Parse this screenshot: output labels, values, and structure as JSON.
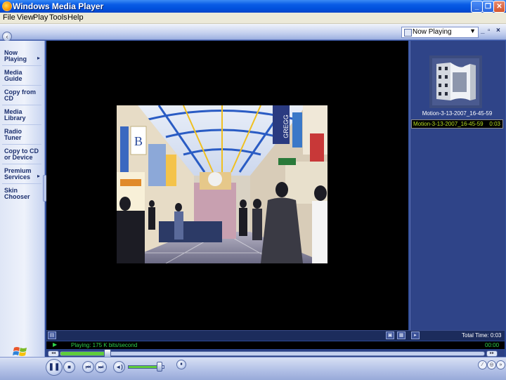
{
  "window": {
    "title": "Windows Media Player"
  },
  "menu": [
    "File",
    "View",
    "Play",
    "Tools",
    "Help"
  ],
  "view_selector": {
    "value": "Now Playing"
  },
  "taskbar": [
    {
      "line1": "Now",
      "line2": "Playing"
    },
    {
      "line1": "Media",
      "line2": "Guide"
    },
    {
      "line1": "Copy from",
      "line2": "CD"
    },
    {
      "line1": "Media",
      "line2": "Library"
    },
    {
      "line1": "Radio",
      "line2": "Tuner"
    },
    {
      "line1": "Copy to CD",
      "line2": "or Device"
    },
    {
      "line1": "Premium",
      "line2": "Services"
    },
    {
      "line1": "Skin",
      "line2": "Chooser"
    }
  ],
  "playlist": {
    "album_title": "Motion-3-13-2007_16-45-59",
    "items": [
      {
        "name": "Motion-3-13-2007_16-45-59",
        "duration": "0:03"
      }
    ],
    "total_time": "Total Time: 0:03"
  },
  "status": {
    "text": "Playing: 175 K bits/second",
    "elapsed": "00:00",
    "progress_fraction": 0.11
  },
  "volume": {
    "level_fraction": 0.85
  },
  "colors": {
    "status_green": "#2fd24a",
    "playlist_text": "#b8e020",
    "frame_blue": "#2f4488"
  }
}
